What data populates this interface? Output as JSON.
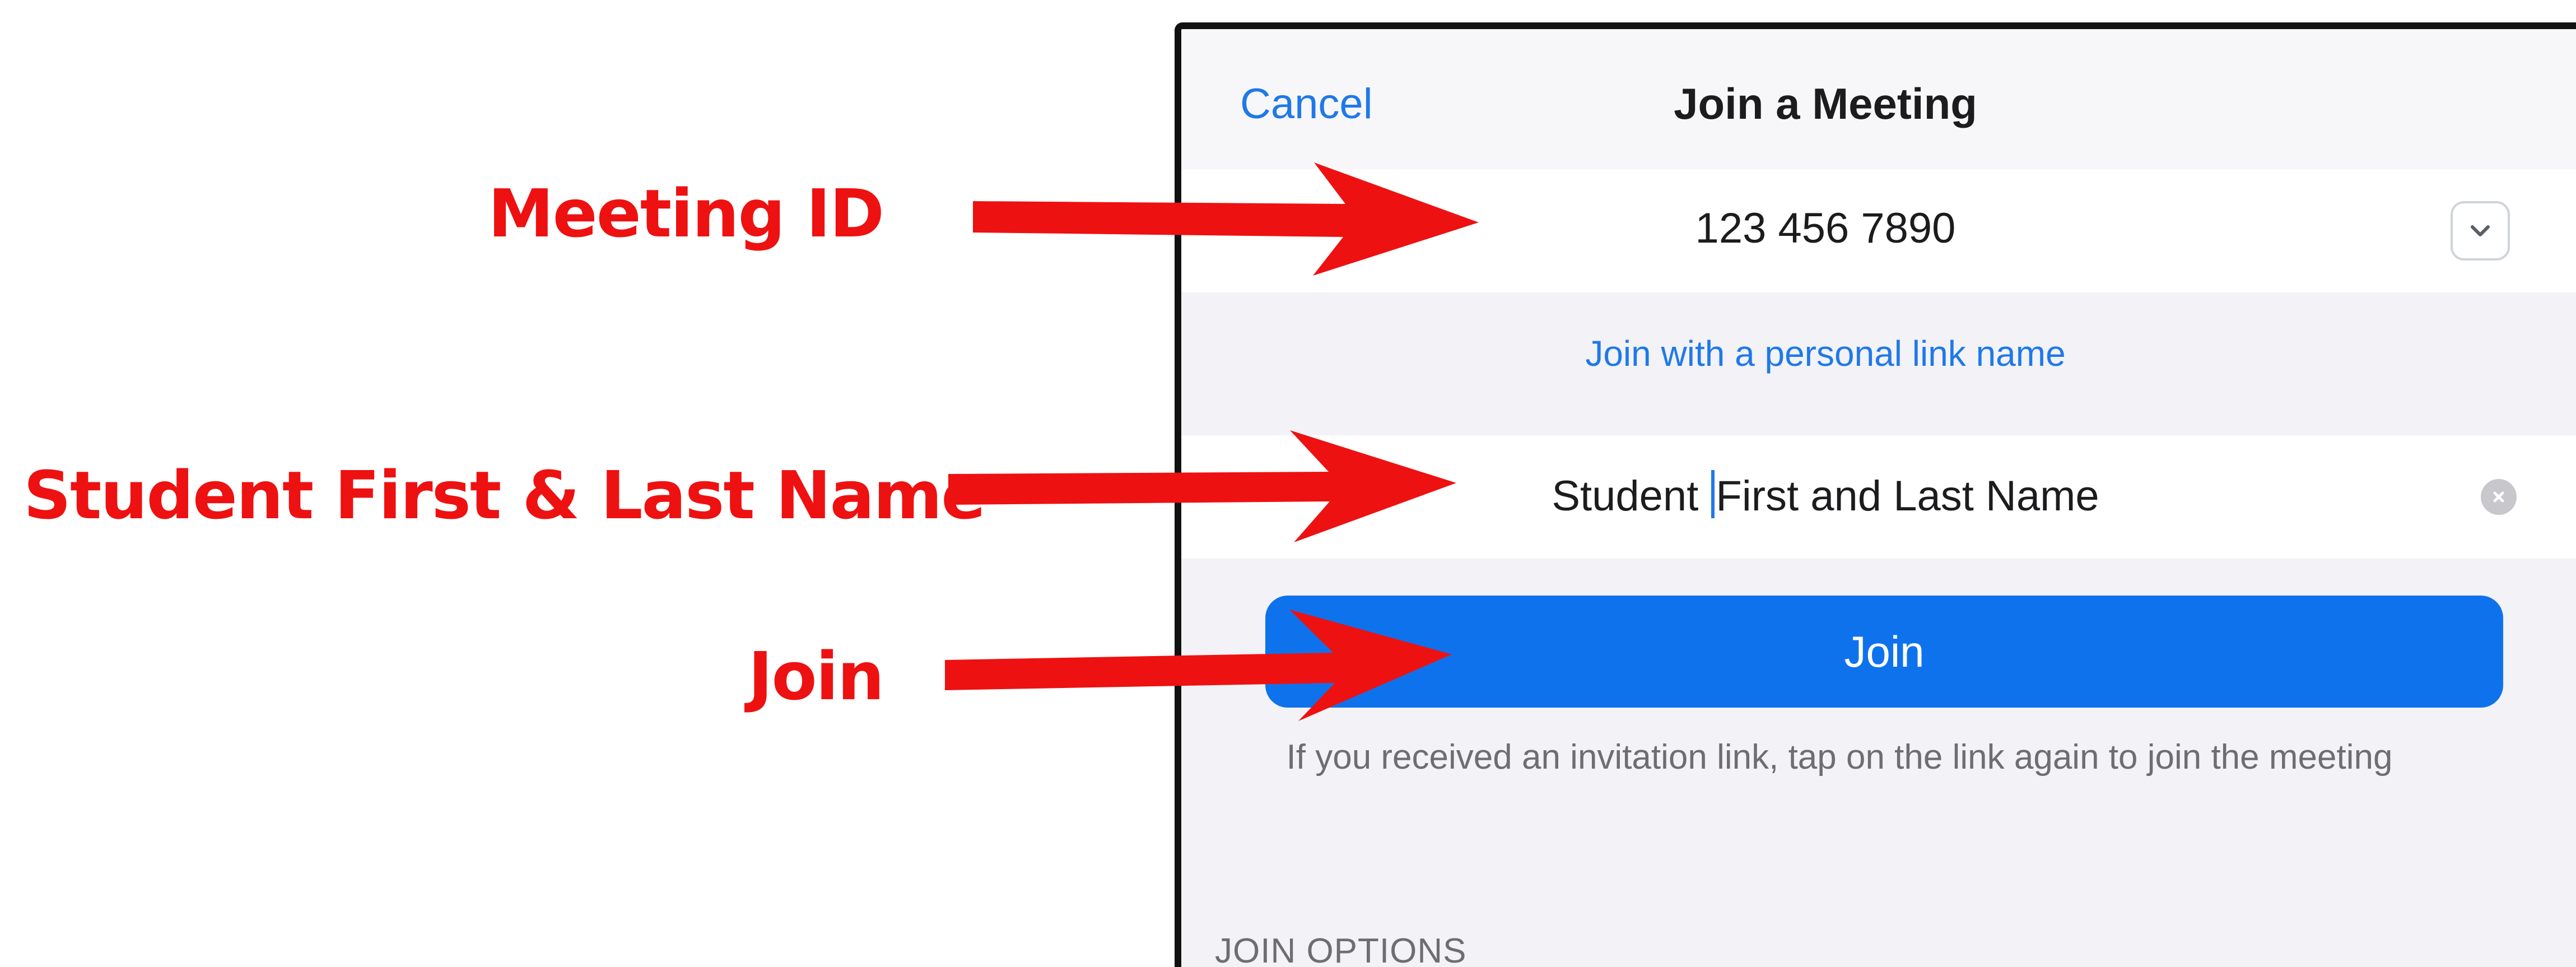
{
  "annotations": {
    "meeting_id_label": "Meeting ID",
    "name_label": "Student First & Last Name",
    "join_label": "Join",
    "arrow_color": "#ee1111"
  },
  "nav": {
    "cancel_label": "Cancel",
    "title": "Join a Meeting"
  },
  "meeting_id": {
    "value": "123 456 7890",
    "dropdown_icon": "chevron-down-icon"
  },
  "personal_link_label": "Join with a personal link name",
  "name_field": {
    "value_before_cursor": "Student ",
    "value_after_cursor": "First and Last Name",
    "clear_icon": "clear-icon"
  },
  "join_button": {
    "label": "Join",
    "color": "#0e72ed"
  },
  "hint_text": "If you received an invitation link, tap on the link again to join the meeting",
  "join_options": {
    "header": "JOIN OPTIONS"
  },
  "colors": {
    "link_blue": "#1f79e8",
    "background_gray": "#f2f2f7"
  }
}
